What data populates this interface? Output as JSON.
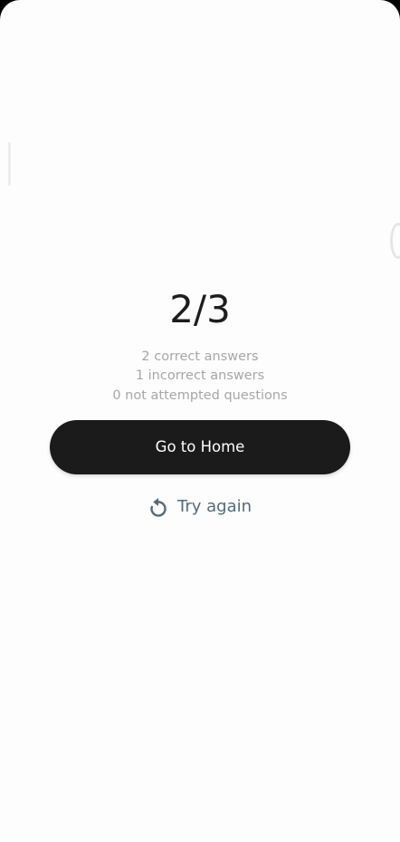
{
  "result": {
    "score": "2/3",
    "stats": [
      "2 correct answers",
      "1 incorrect answers",
      "0 not attempted questions"
    ]
  },
  "actions": {
    "home_label": "Go to Home",
    "retry_label": "Try again",
    "retry_icon": "retry-icon"
  },
  "colors": {
    "background": "#fdfdfd",
    "primary_button": "#1b1b1b",
    "primary_button_text": "#ffffff",
    "secondary_text": "#a7a7a7",
    "link": "#566a7a"
  }
}
